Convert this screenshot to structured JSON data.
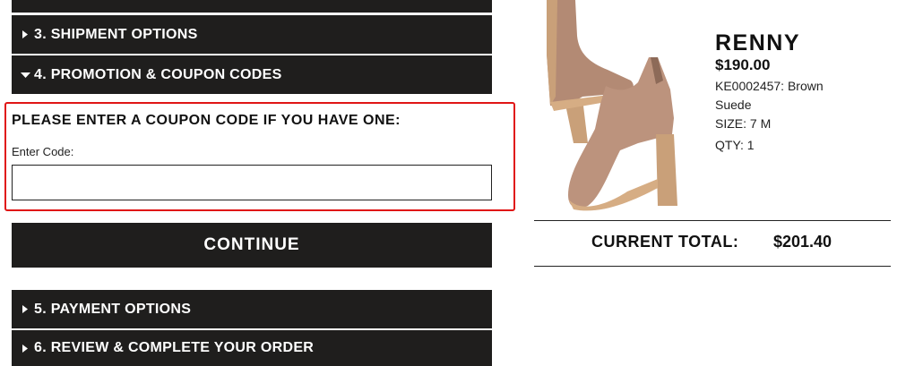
{
  "checkout": {
    "steps": {
      "shipment": "3. SHIPMENT OPTIONS",
      "promotion": "4. PROMOTION & COUPON CODES",
      "payment": "5. PAYMENT OPTIONS",
      "review": "6. REVIEW & COMPLETE YOUR ORDER"
    },
    "coupon": {
      "title": "PLEASE ENTER A COUPON CODE IF YOU HAVE ONE:",
      "field_label": "Enter Code:",
      "value": ""
    },
    "continue_label": "CONTINUE"
  },
  "cart": {
    "product": {
      "name": "RENNY",
      "price": "$190.00",
      "sku": "KE0002457: Brown Suede",
      "size": "SIZE: 7 M",
      "qty": "QTY: 1"
    },
    "total_label": "CURRENT TOTAL:",
    "total_value": "$201.40"
  },
  "colors": {
    "bar": "#1f1e1d",
    "highlight_border": "#e01616",
    "boot_suede": "#b9907a",
    "sole": "#c9a079"
  },
  "icons": {
    "collapsed": "caret-right-icon",
    "expanded": "caret-down-icon"
  }
}
